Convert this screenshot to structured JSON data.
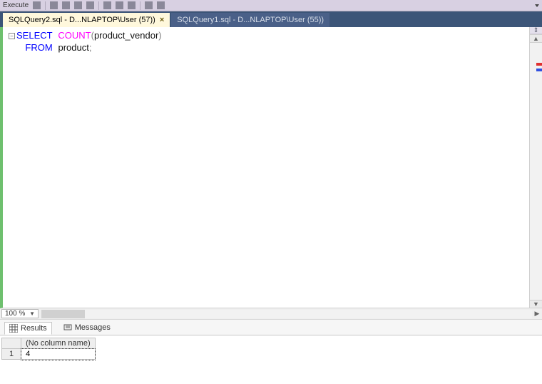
{
  "toolbar": {
    "execute_label": "Execute"
  },
  "tabs": {
    "active": "SQLQuery2.sql - D...NLAPTOP\\User (57))",
    "inactive": "SQLQuery1.sql - D...NLAPTOP\\User (55))",
    "close_glyph": "×"
  },
  "code": {
    "outline_glyph": "−",
    "select_kw": "SELECT",
    "count_fn": "COUNT",
    "lparen": "(",
    "arg": "product_vendor",
    "rparen": ")",
    "from_kw": "FROM",
    "table": "product",
    "semi": ";"
  },
  "zoom": {
    "value": "100 %"
  },
  "bottom_tabs": {
    "results": "Results",
    "messages": "Messages"
  },
  "grid": {
    "blank_header": "",
    "col1_header": "(No column name)",
    "row1_num": "1",
    "row1_val": "4"
  }
}
